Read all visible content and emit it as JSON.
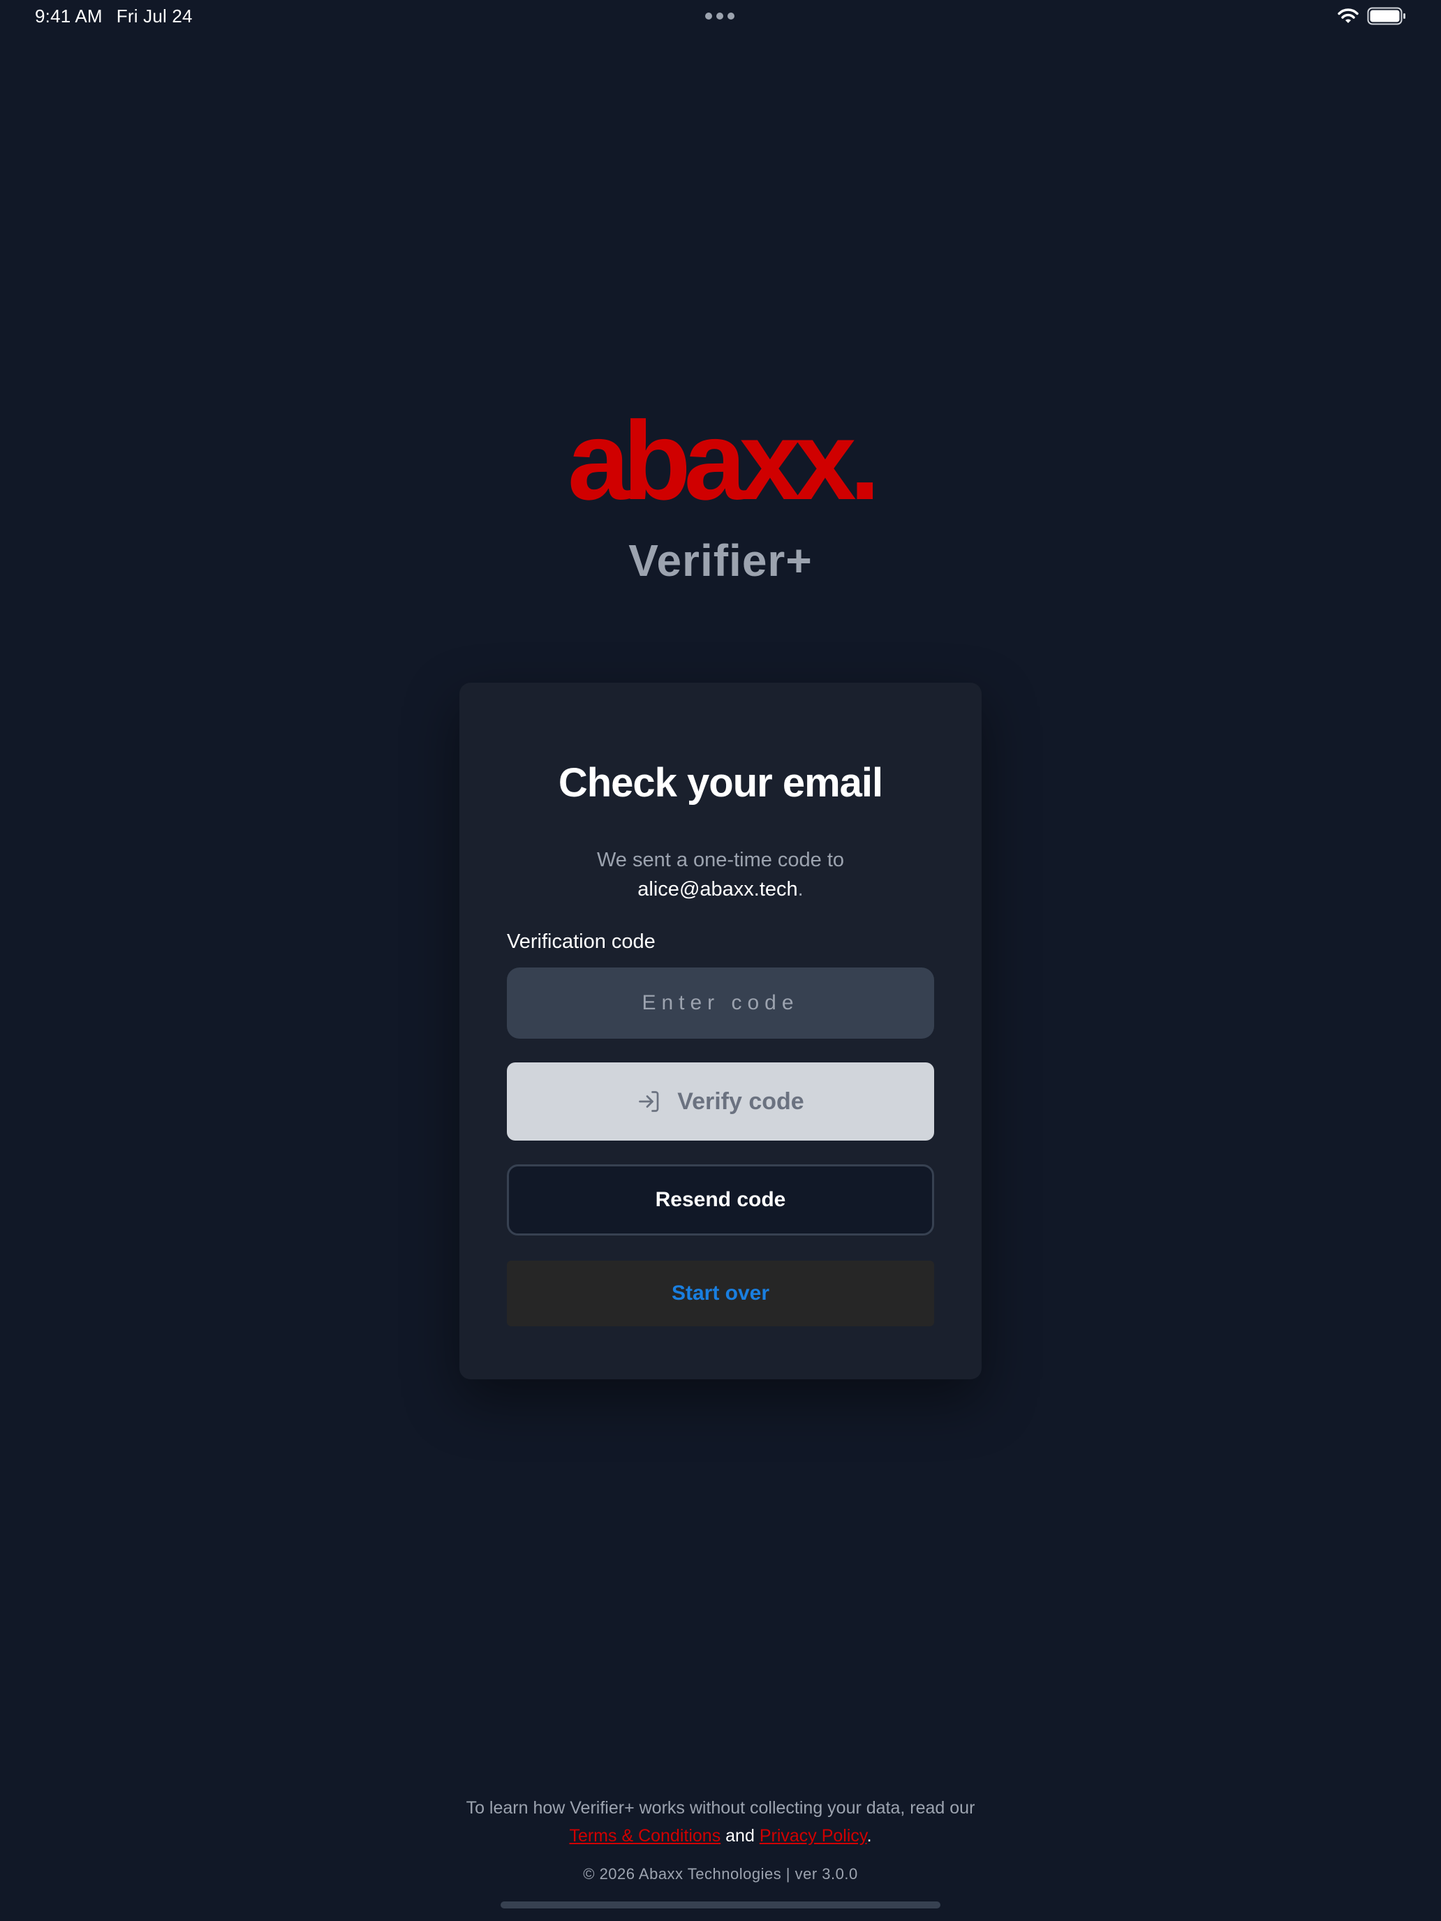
{
  "status_bar": {
    "time": "9:41 AM",
    "date": "Fri Jul 24"
  },
  "brand": {
    "logo_text": "abaxx.",
    "app_name": "Verifier+",
    "logo_color": "#d00000"
  },
  "card": {
    "title": "Check your email",
    "desc_prefix": "We sent a one-time code to",
    "email": "alice@abaxx.tech",
    "desc_suffix": ".",
    "field_label": "Verification code",
    "code_placeholder": "Enter code",
    "code_value": "",
    "verify_label": "Verify code",
    "verify_icon": "sign-in-icon",
    "resend_label": "Resend code",
    "start_over_label": "Start over"
  },
  "footer": {
    "line1": "To learn how Verifier+ works without collecting your data, read our",
    "terms_link": "Terms & Conditions",
    "and_text": "and",
    "privacy_link": "Privacy Policy",
    "end_punct": ".",
    "copyright": "© 2026 Abaxx Technologies | ver 3.0.0"
  },
  "colors": {
    "background": "#111827",
    "card": "#1a202d",
    "accent_link": "#1a7fe0",
    "brand_red": "#d00000"
  }
}
